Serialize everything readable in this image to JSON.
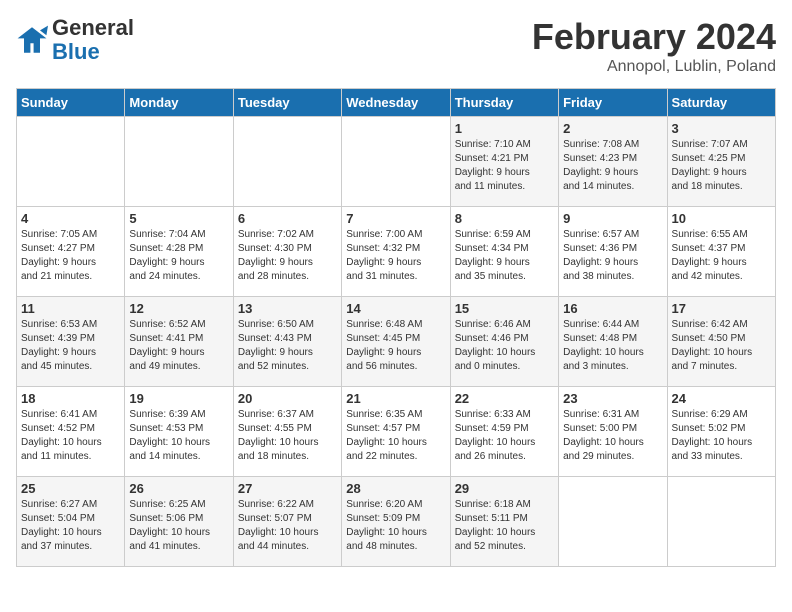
{
  "header": {
    "logo_general": "General",
    "logo_blue": "Blue",
    "title": "February 2024",
    "subtitle": "Annopol, Lublin, Poland"
  },
  "weekdays": [
    "Sunday",
    "Monday",
    "Tuesday",
    "Wednesday",
    "Thursday",
    "Friday",
    "Saturday"
  ],
  "weeks": [
    [
      {
        "day": "",
        "info": ""
      },
      {
        "day": "",
        "info": ""
      },
      {
        "day": "",
        "info": ""
      },
      {
        "day": "",
        "info": ""
      },
      {
        "day": "1",
        "info": "Sunrise: 7:10 AM\nSunset: 4:21 PM\nDaylight: 9 hours\nand 11 minutes."
      },
      {
        "day": "2",
        "info": "Sunrise: 7:08 AM\nSunset: 4:23 PM\nDaylight: 9 hours\nand 14 minutes."
      },
      {
        "day": "3",
        "info": "Sunrise: 7:07 AM\nSunset: 4:25 PM\nDaylight: 9 hours\nand 18 minutes."
      }
    ],
    [
      {
        "day": "4",
        "info": "Sunrise: 7:05 AM\nSunset: 4:27 PM\nDaylight: 9 hours\nand 21 minutes."
      },
      {
        "day": "5",
        "info": "Sunrise: 7:04 AM\nSunset: 4:28 PM\nDaylight: 9 hours\nand 24 minutes."
      },
      {
        "day": "6",
        "info": "Sunrise: 7:02 AM\nSunset: 4:30 PM\nDaylight: 9 hours\nand 28 minutes."
      },
      {
        "day": "7",
        "info": "Sunrise: 7:00 AM\nSunset: 4:32 PM\nDaylight: 9 hours\nand 31 minutes."
      },
      {
        "day": "8",
        "info": "Sunrise: 6:59 AM\nSunset: 4:34 PM\nDaylight: 9 hours\nand 35 minutes."
      },
      {
        "day": "9",
        "info": "Sunrise: 6:57 AM\nSunset: 4:36 PM\nDaylight: 9 hours\nand 38 minutes."
      },
      {
        "day": "10",
        "info": "Sunrise: 6:55 AM\nSunset: 4:37 PM\nDaylight: 9 hours\nand 42 minutes."
      }
    ],
    [
      {
        "day": "11",
        "info": "Sunrise: 6:53 AM\nSunset: 4:39 PM\nDaylight: 9 hours\nand 45 minutes."
      },
      {
        "day": "12",
        "info": "Sunrise: 6:52 AM\nSunset: 4:41 PM\nDaylight: 9 hours\nand 49 minutes."
      },
      {
        "day": "13",
        "info": "Sunrise: 6:50 AM\nSunset: 4:43 PM\nDaylight: 9 hours\nand 52 minutes."
      },
      {
        "day": "14",
        "info": "Sunrise: 6:48 AM\nSunset: 4:45 PM\nDaylight: 9 hours\nand 56 minutes."
      },
      {
        "day": "15",
        "info": "Sunrise: 6:46 AM\nSunset: 4:46 PM\nDaylight: 10 hours\nand 0 minutes."
      },
      {
        "day": "16",
        "info": "Sunrise: 6:44 AM\nSunset: 4:48 PM\nDaylight: 10 hours\nand 3 minutes."
      },
      {
        "day": "17",
        "info": "Sunrise: 6:42 AM\nSunset: 4:50 PM\nDaylight: 10 hours\nand 7 minutes."
      }
    ],
    [
      {
        "day": "18",
        "info": "Sunrise: 6:41 AM\nSunset: 4:52 PM\nDaylight: 10 hours\nand 11 minutes."
      },
      {
        "day": "19",
        "info": "Sunrise: 6:39 AM\nSunset: 4:53 PM\nDaylight: 10 hours\nand 14 minutes."
      },
      {
        "day": "20",
        "info": "Sunrise: 6:37 AM\nSunset: 4:55 PM\nDaylight: 10 hours\nand 18 minutes."
      },
      {
        "day": "21",
        "info": "Sunrise: 6:35 AM\nSunset: 4:57 PM\nDaylight: 10 hours\nand 22 minutes."
      },
      {
        "day": "22",
        "info": "Sunrise: 6:33 AM\nSunset: 4:59 PM\nDaylight: 10 hours\nand 26 minutes."
      },
      {
        "day": "23",
        "info": "Sunrise: 6:31 AM\nSunset: 5:00 PM\nDaylight: 10 hours\nand 29 minutes."
      },
      {
        "day": "24",
        "info": "Sunrise: 6:29 AM\nSunset: 5:02 PM\nDaylight: 10 hours\nand 33 minutes."
      }
    ],
    [
      {
        "day": "25",
        "info": "Sunrise: 6:27 AM\nSunset: 5:04 PM\nDaylight: 10 hours\nand 37 minutes."
      },
      {
        "day": "26",
        "info": "Sunrise: 6:25 AM\nSunset: 5:06 PM\nDaylight: 10 hours\nand 41 minutes."
      },
      {
        "day": "27",
        "info": "Sunrise: 6:22 AM\nSunset: 5:07 PM\nDaylight: 10 hours\nand 44 minutes."
      },
      {
        "day": "28",
        "info": "Sunrise: 6:20 AM\nSunset: 5:09 PM\nDaylight: 10 hours\nand 48 minutes."
      },
      {
        "day": "29",
        "info": "Sunrise: 6:18 AM\nSunset: 5:11 PM\nDaylight: 10 hours\nand 52 minutes."
      },
      {
        "day": "",
        "info": ""
      },
      {
        "day": "",
        "info": ""
      }
    ]
  ]
}
